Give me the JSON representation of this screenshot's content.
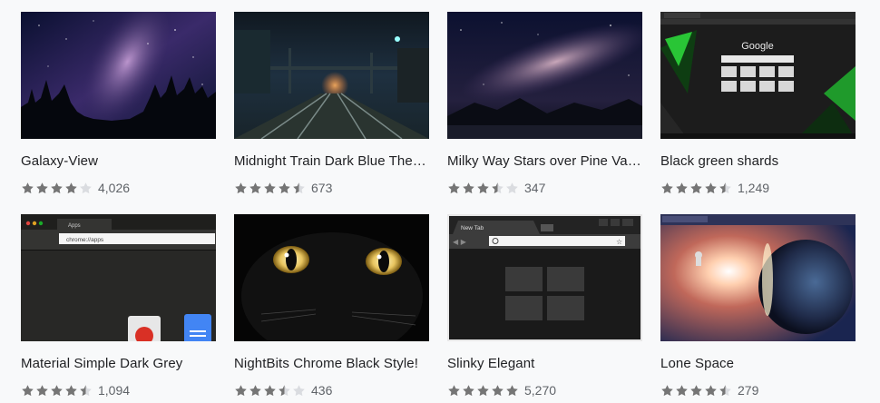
{
  "themes": [
    {
      "title": "Galaxy-View",
      "rating": 4.0,
      "count": "4,026",
      "thumb": "galaxy-forest"
    },
    {
      "title": "Midnight Train Dark Blue Theme",
      "rating": 4.5,
      "count": "673",
      "thumb": "train-tracks"
    },
    {
      "title": "Milky Way Stars over Pine Vall...",
      "rating": 3.5,
      "count": "347",
      "thumb": "milky-way-mountains"
    },
    {
      "title": "Black green shards",
      "rating": 4.5,
      "count": "1,249",
      "thumb": "google-newtab-green"
    },
    {
      "title": "Material Simple Dark Grey",
      "rating": 4.5,
      "count": "1,094",
      "thumb": "chrome-apps-dark"
    },
    {
      "title": "NightBits Chrome Black Style!",
      "rating": 3.5,
      "count": "436",
      "thumb": "black-cat"
    },
    {
      "title": "Slinky Elegant",
      "rating": 5.0,
      "count": "5,270",
      "thumb": "chrome-newtab-black"
    },
    {
      "title": "Lone Space",
      "rating": 4.5,
      "count": "279",
      "thumb": "planet-astronaut"
    }
  ],
  "thumb_text": {
    "google": "Google",
    "new_tab": "New Tab",
    "apps_tab": "Apps",
    "apps_url": "chrome://apps"
  },
  "colors": {
    "star_filled": "#757575",
    "star_empty": "#dadce0",
    "title": "#202124",
    "count": "#5f6368"
  }
}
